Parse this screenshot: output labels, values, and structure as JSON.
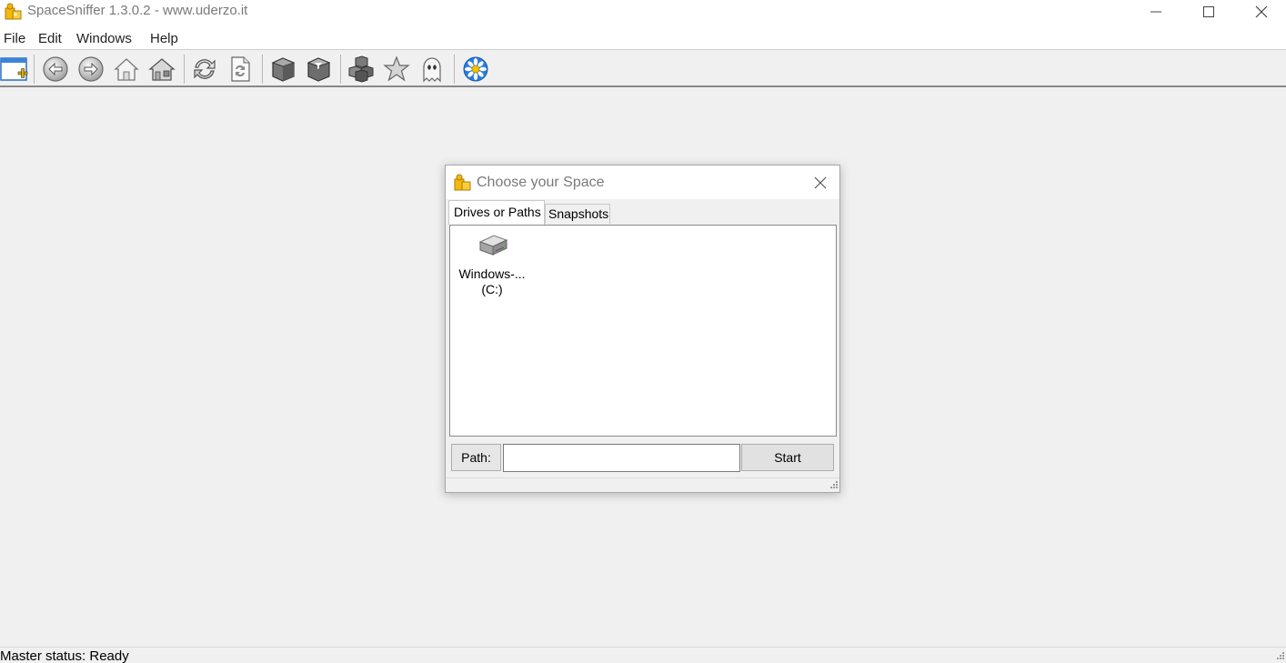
{
  "window": {
    "title": "SpaceSniffer 1.3.0.2 - www.uderzo.it"
  },
  "menu": {
    "items": [
      "File",
      "Edit",
      "Windows",
      "Help"
    ]
  },
  "toolbar": {
    "buttons": [
      {
        "icon": "new-window-icon"
      },
      {
        "icon": "back-arrow-icon"
      },
      {
        "icon": "forward-arrow-icon"
      },
      {
        "icon": "home-outline-icon"
      },
      {
        "icon": "home-icon"
      },
      {
        "icon": "refresh-icon"
      },
      {
        "icon": "refresh-document-icon"
      },
      {
        "icon": "cube-icon"
      },
      {
        "icon": "cube-filter-icon"
      },
      {
        "icon": "cubes-icon"
      },
      {
        "icon": "star-icon"
      },
      {
        "icon": "ghost-icon"
      },
      {
        "icon": "flower-icon"
      }
    ]
  },
  "dialog": {
    "title": "Choose your Space",
    "tabs": [
      {
        "label": "Drives or Paths",
        "active": true
      },
      {
        "label": "Snapshots",
        "active": false
      }
    ],
    "drives": [
      {
        "label_line1": "Windows-...",
        "label_line2": "(C:)",
        "icon": "hard-drive-icon"
      }
    ],
    "path_label": "Path:",
    "path_value": "",
    "start_label": "Start"
  },
  "statusbar": {
    "text": "Master status: Ready"
  }
}
